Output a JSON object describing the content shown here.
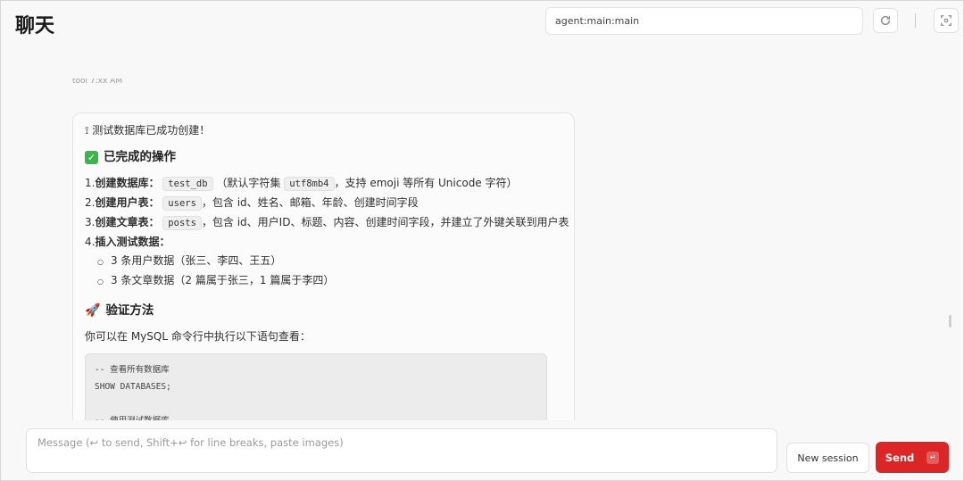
{
  "header": {
    "title": "聊天",
    "session_value": "agent:main:main",
    "refresh_icon": "refresh-icon",
    "focus_icon": "focus-icon"
  },
  "message": {
    "meta": "tool 7:xx AM",
    "intro_icon": "sparkle-icon",
    "intro": "测试数据库已成功创建！",
    "section1": {
      "icon": "check-icon",
      "title": "已完成的操作"
    },
    "items": [
      {
        "num": "1.",
        "label": "创建数据库：",
        "code": "test_db",
        "mid": "（默认字符集",
        "code2": "utf8mb4",
        "rest": "，支持 emoji 等所有 Unicode 字符）"
      },
      {
        "num": "2.",
        "label": "创建用户表：",
        "code": "users",
        "rest": "，包含 id、姓名、邮箱、年龄、创建时间字段"
      },
      {
        "num": "3.",
        "label": "创建文章表：",
        "code": "posts",
        "rest": "，包含 id、用户ID、标题、内容、创建时间字段，并建立了外键关联到用户表"
      },
      {
        "num": "4.",
        "label": "插入测试数据：",
        "subs": [
          "3 条用户数据（张三、李四、王五）",
          "3 条文章数据（2 篇属于张三，1 篇属于李四）"
        ]
      }
    ],
    "section2": {
      "icon": "rocket-icon",
      "title": "验证方法"
    },
    "verify_text": "你可以在 MySQL 命令行中执行以下语句查看：",
    "code_lines": [
      "-- 查看所有数据库",
      "SHOW DATABASES;",
      "",
      "-- 使用测试数据库"
    ]
  },
  "composer": {
    "placeholder": "Message (↩ to send, Shift+↩ for line breaks, paste images)"
  },
  "actions": {
    "new_session": "New session",
    "send": "Send",
    "send_kbd": "↵"
  },
  "colors": {
    "accent": "#dc2626",
    "check": "#3bb54a"
  }
}
